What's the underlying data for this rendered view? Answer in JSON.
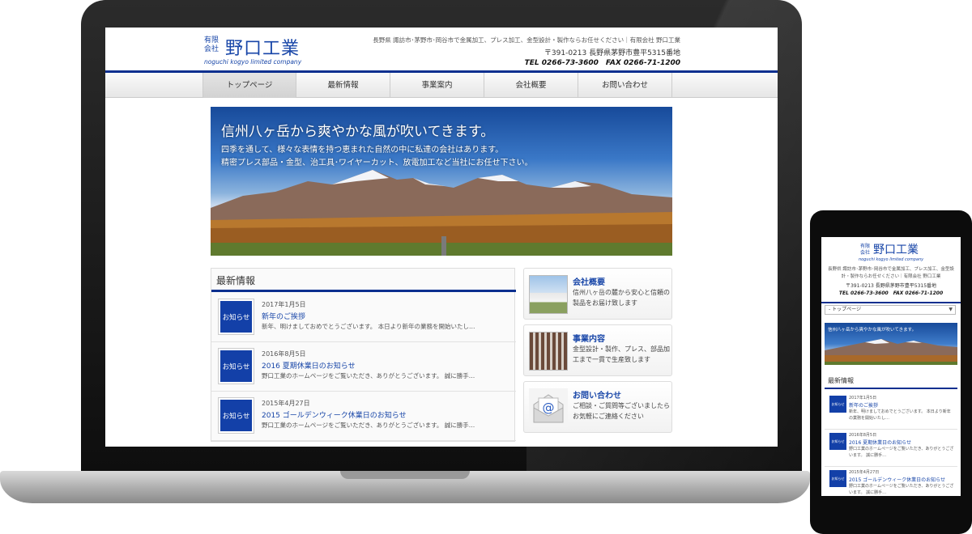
{
  "site": {
    "logo_small": "有限\n会社",
    "logo_main": "野口工業",
    "logo_sub": "noguchi kogyo limited company",
    "description": "長野県 諏訪市･茅野市･岡谷市で金属加工、プレス加工、金型設計・製作ならお任せください｜有限会社 野口工業",
    "address": "〒391-0213 長野県茅野市豊平5315番地",
    "tel_fax": "TEL 0266-73-3600　FAX 0266-71-1200"
  },
  "nav": [
    {
      "label": "トップページ"
    },
    {
      "label": "最新情報"
    },
    {
      "label": "事業案内"
    },
    {
      "label": "会社概要"
    },
    {
      "label": "お問い合わせ"
    }
  ],
  "hero": {
    "title": "信州八ヶ岳から爽やかな風が吹いてきます。",
    "line1": "四季を通して、様々な表情を持つ恵まれた自然の中に私達の会社はあります。",
    "line2": "精密プレス部品・金型、治工具･ワイヤーカット、放電加工など当社にお任せ下さい。"
  },
  "news": {
    "heading": "最新情報",
    "items": [
      {
        "badge": "お知らせ",
        "date": "2017年1月5日",
        "title": "新年のご挨拶",
        "excerpt": "新年、明けましておめでとうございます。 本日より新年の業務を開始いたし…"
      },
      {
        "badge": "お知らせ",
        "date": "2016年8月5日",
        "title": "2016 夏期休業日のお知らせ",
        "excerpt": "野口工業のホームページをご覧いただき、ありがとうございます。 誠に勝手…"
      },
      {
        "badge": "お知らせ",
        "date": "2015年4月27日",
        "title": "2015 ゴールデンウィーク休業日のお知らせ",
        "excerpt": "野口工業のホームページをご覧いただき、ありがとうございます。 誠に勝手…"
      }
    ]
  },
  "side_cards": [
    {
      "title": "会社概要",
      "text": "信州八ヶ岳の麓から安心と信頼の製品をお届け致します",
      "icon": "building-photo"
    },
    {
      "title": "事業内容",
      "text": "金型設計・製作、プレス、部品加工まで一貫で生産致します",
      "icon": "parts-photo"
    },
    {
      "title": "お問い合わせ",
      "text": "ご相談・ご質問等ございましたらお気軽にご連絡ください",
      "icon": "mail-at-icon"
    }
  ],
  "phone": {
    "select_value": "- トップページ",
    "hero_title": "信州八ヶ岳から爽やかな風が吹いてきます。",
    "news_heading": "最新情報",
    "news": [
      {
        "badge": "お知らせ",
        "date": "2017年1月5日",
        "title": "新年のご挨拶",
        "excerpt": "新年、明けましておめでとうございます。 本日より新年の業務を開始いたし…"
      },
      {
        "badge": "お知らせ",
        "date": "2016年8月5日",
        "title": "2016 夏期休業日のお知らせ",
        "excerpt": "野口工業のホームページをご覧いただき、ありがとうございます。 誠に勝手…"
      },
      {
        "badge": "お知らせ",
        "date": "2015年4月27日",
        "title": "2015 ゴールデンウィーク休業日のお知らせ",
        "excerpt": "野口工業のホームページをご覧いただき、ありがとうございます。 誠に勝手…"
      }
    ]
  },
  "colors": {
    "brand_blue": "#1846a8",
    "nav_rule": "#0a2f8f",
    "badge_bg": "#1340a8"
  }
}
